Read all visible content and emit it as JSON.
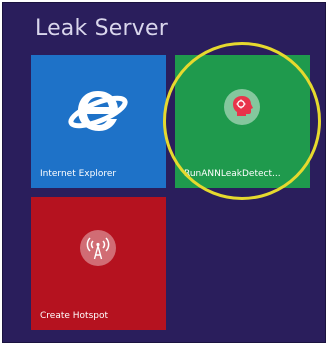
{
  "group": {
    "title": "Leak Server"
  },
  "tiles": [
    {
      "label": "Internet Explorer",
      "color": "#1e72c8",
      "icon": "internet-explorer-icon"
    },
    {
      "label": "RunANNLeakDetect...",
      "color": "#1f9a4d",
      "icon": "head-profile-icon"
    },
    {
      "label": "Create Hotspot",
      "color": "#b5121f",
      "icon": "broadcast-antenna-icon"
    }
  ],
  "highlight": {
    "color": "#e6d92e"
  }
}
